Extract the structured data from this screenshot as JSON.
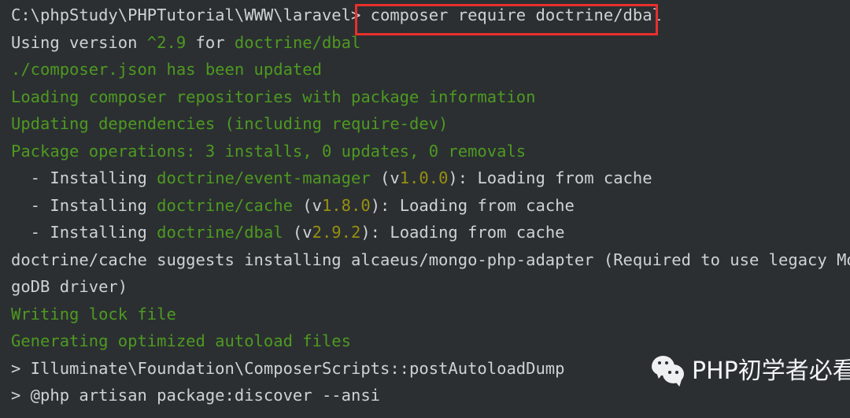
{
  "terminal": {
    "background_color": "#2b2f32",
    "default_text_color": "#cfd2d4",
    "green_color": "#4e9a20",
    "version_color": "#97900f",
    "highlight_color": "#e8302c",
    "prompt": "C:\\phpStudy\\PHPTutorial\\WWW\\laravel>",
    "typed_command": "composer require doctrine/dbal",
    "lines": [
      {
        "name": "prompt-line",
        "segments": [
          {
            "text": "C:\\phpStudy\\PHPTutorial\\WWW\\laravel> ",
            "color": "gray"
          },
          {
            "text": "composer require doctrine/dbal",
            "color": "gray"
          }
        ]
      },
      {
        "name": "using-version-line",
        "segments": [
          {
            "text": "Using version ",
            "color": "gray"
          },
          {
            "text": "^2.9",
            "color": "green"
          },
          {
            "text": " for ",
            "color": "gray"
          },
          {
            "text": "doctrine/dbal",
            "color": "green"
          }
        ]
      },
      {
        "name": "composer-json-updated-line",
        "segments": [
          {
            "text": "./composer.json has been updated",
            "color": "green"
          }
        ]
      },
      {
        "name": "loading-repositories-line",
        "segments": [
          {
            "text": "Loading composer repositories with package information",
            "color": "green"
          }
        ]
      },
      {
        "name": "updating-dependencies-line",
        "segments": [
          {
            "text": "Updating dependencies (including require-dev)",
            "color": "green"
          }
        ]
      },
      {
        "name": "package-operations-line",
        "segments": [
          {
            "text": "Package operations: 3 installs, 0 updates, 0 removals",
            "color": "green"
          }
        ]
      },
      {
        "name": "installing-event-manager-line",
        "segments": [
          {
            "text": "  - Installing ",
            "color": "gray"
          },
          {
            "text": "doctrine/event-manager",
            "color": "green"
          },
          {
            "text": " (v",
            "color": "gray"
          },
          {
            "text": "1.0.0",
            "color": "version"
          },
          {
            "text": "): Loading from cache",
            "color": "gray"
          }
        ]
      },
      {
        "name": "installing-cache-line",
        "segments": [
          {
            "text": "  - Installing ",
            "color": "gray"
          },
          {
            "text": "doctrine/cache",
            "color": "green"
          },
          {
            "text": " (v",
            "color": "gray"
          },
          {
            "text": "1.8.0",
            "color": "version"
          },
          {
            "text": "): Loading from cache",
            "color": "gray"
          }
        ]
      },
      {
        "name": "installing-dbal-line",
        "segments": [
          {
            "text": "  - Installing ",
            "color": "gray"
          },
          {
            "text": "doctrine/dbal",
            "color": "green"
          },
          {
            "text": " (v",
            "color": "gray"
          },
          {
            "text": "2.9.2",
            "color": "version"
          },
          {
            "text": "): Loading from cache",
            "color": "gray"
          }
        ]
      },
      {
        "name": "suggests-line-part1",
        "segments": [
          {
            "text": "doctrine/cache suggests installing alcaeus/mongo-php-adapter (Required to use legacy Mon",
            "color": "gray"
          }
        ]
      },
      {
        "name": "suggests-line-part2",
        "segments": [
          {
            "text": "goDB driver)",
            "color": "gray"
          }
        ]
      },
      {
        "name": "writing-lock-file-line",
        "segments": [
          {
            "text": "Writing lock file",
            "color": "green"
          }
        ]
      },
      {
        "name": "generating-autoload-line",
        "segments": [
          {
            "text": "Generating optimized autoload files",
            "color": "green"
          }
        ]
      },
      {
        "name": "post-autoload-dump-line",
        "segments": [
          {
            "text": "> Illuminate\\Foundation\\ComposerScripts::postAutoloadDump",
            "color": "gray"
          }
        ]
      },
      {
        "name": "package-discover-line",
        "segments": [
          {
            "text": "> @php artisan package:discover --ansi",
            "color": "gray"
          }
        ]
      }
    ]
  },
  "watermark": {
    "icon": "wechat-icon",
    "text": "PHP初学者必看",
    "text_color": "#f2f4f5"
  }
}
